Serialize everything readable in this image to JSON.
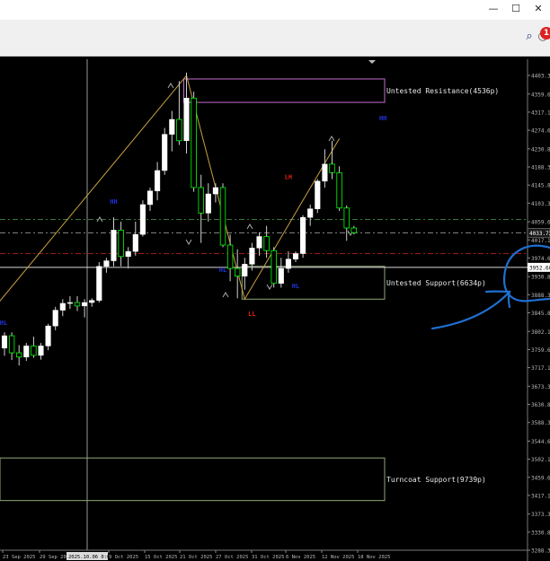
{
  "window": {
    "minimize_glyph": "—",
    "maximize_glyph": "☐",
    "close_glyph": "✕"
  },
  "toolbar": {
    "icons": [
      "search-icon",
      "notification-icon"
    ],
    "notification_badge": "1"
  },
  "colors": {
    "background": "#000000",
    "bull_candle": "#ffffff",
    "bear_candle": "#000000",
    "wick": "#ffffff",
    "zigzag": "#c8a040",
    "resistance_zone": "#c46fd0",
    "support_zone": "#8fa97a",
    "turncoat_zone": "#8fa97a",
    "swing_high_label": "#2233dd",
    "swing_low_label": "#dd2211",
    "annotation_pen": "#1f6fd0",
    "axis_text": "#b8b8b8"
  },
  "chart_data": {
    "type": "candlestick",
    "instrument_price_axis": {
      "ticks": [
        "4403.35",
        "4359.60",
        "4317.10",
        "4274.60",
        "4230.85",
        "4188.35",
        "4145.85",
        "4103.35",
        "4059.60",
        "4017.10",
        "3974.60",
        "3930.85",
        "3888.35",
        "3845.85",
        "3802.10",
        "3759.60",
        "3717.10",
        "3673.35",
        "3630.85",
        "3588.35",
        "3544.60",
        "3502.10",
        "3459.60",
        "3417.10",
        "3373.35",
        "3330.85",
        "3288.35"
      ],
      "ylim": [
        3288.35,
        4403.35
      ],
      "current_price": "4033.73",
      "marked_price": "3952.60"
    },
    "time_axis": {
      "ticks": [
        "23 Sep 2025",
        "29 Sep 2025",
        "2025.10.06 0:00",
        "9 Oct 2025",
        "15 Oct 2025",
        "21 Oct 2025",
        "27 Oct 2025",
        "31 Oct 2025",
        "6 Nov 2025",
        "12 Nov 2025",
        "18 Nov 2025"
      ],
      "crosshair_label": "2025.10.06 0:00"
    },
    "candles": [
      {
        "o": 3763,
        "h": 3800,
        "l": 3745,
        "c": 3792
      },
      {
        "o": 3792,
        "h": 3800,
        "l": 3735,
        "c": 3752
      },
      {
        "o": 3752,
        "h": 3770,
        "l": 3722,
        "c": 3742
      },
      {
        "o": 3742,
        "h": 3775,
        "l": 3733,
        "c": 3768
      },
      {
        "o": 3768,
        "h": 3790,
        "l": 3740,
        "c": 3746
      },
      {
        "o": 3746,
        "h": 3775,
        "l": 3736,
        "c": 3768
      },
      {
        "o": 3768,
        "h": 3820,
        "l": 3758,
        "c": 3815
      },
      {
        "o": 3815,
        "h": 3860,
        "l": 3805,
        "c": 3852
      },
      {
        "o": 3852,
        "h": 3878,
        "l": 3838,
        "c": 3868
      },
      {
        "o": 3868,
        "h": 3885,
        "l": 3855,
        "c": 3870
      },
      {
        "o": 3870,
        "h": 3885,
        "l": 3850,
        "c": 3862
      },
      {
        "o": 3862,
        "h": 3878,
        "l": 3835,
        "c": 3870
      },
      {
        "o": 3870,
        "h": 3880,
        "l": 3860,
        "c": 3875
      },
      {
        "o": 3875,
        "h": 3965,
        "l": 3870,
        "c": 3955
      },
      {
        "o": 3955,
        "h": 3975,
        "l": 3940,
        "c": 3968
      },
      {
        "o": 3968,
        "h": 4070,
        "l": 3955,
        "c": 4040
      },
      {
        "o": 4040,
        "h": 4060,
        "l": 3955,
        "c": 3978
      },
      {
        "o": 3978,
        "h": 4000,
        "l": 3950,
        "c": 3990
      },
      {
        "o": 3990,
        "h": 4060,
        "l": 3980,
        "c": 4030
      },
      {
        "o": 4030,
        "h": 4110,
        "l": 4025,
        "c": 4100
      },
      {
        "o": 4100,
        "h": 4140,
        "l": 4085,
        "c": 4132
      },
      {
        "o": 4132,
        "h": 4200,
        "l": 4110,
        "c": 4180
      },
      {
        "o": 4180,
        "h": 4280,
        "l": 4170,
        "c": 4265
      },
      {
        "o": 4265,
        "h": 4320,
        "l": 4225,
        "c": 4300
      },
      {
        "o": 4300,
        "h": 4390,
        "l": 4240,
        "c": 4250
      },
      {
        "o": 4250,
        "h": 4410,
        "l": 4220,
        "c": 4350
      },
      {
        "o": 4350,
        "h": 4365,
        "l": 4130,
        "c": 4140
      },
      {
        "o": 4140,
        "h": 4170,
        "l": 4010,
        "c": 4080
      },
      {
        "o": 4080,
        "h": 4150,
        "l": 4060,
        "c": 4125
      },
      {
        "o": 4125,
        "h": 4150,
        "l": 4105,
        "c": 4140
      },
      {
        "o": 4140,
        "h": 4150,
        "l": 4000,
        "c": 4005
      },
      {
        "o": 4005,
        "h": 4030,
        "l": 3920,
        "c": 3950
      },
      {
        "o": 3950,
        "h": 3995,
        "l": 3880,
        "c": 3932
      },
      {
        "o": 3932,
        "h": 3975,
        "l": 3900,
        "c": 3960
      },
      {
        "o": 3960,
        "h": 4010,
        "l": 3945,
        "c": 3998
      },
      {
        "o": 3998,
        "h": 4035,
        "l": 3980,
        "c": 4025
      },
      {
        "o": 4025,
        "h": 4050,
        "l": 3975,
        "c": 3992
      },
      {
        "o": 3992,
        "h": 4000,
        "l": 3905,
        "c": 3915
      },
      {
        "o": 3915,
        "h": 3975,
        "l": 3905,
        "c": 3950
      },
      {
        "o": 3950,
        "h": 3990,
        "l": 3940,
        "c": 3972
      },
      {
        "o": 3972,
        "h": 3990,
        "l": 3965,
        "c": 3985
      },
      {
        "o": 3985,
        "h": 4075,
        "l": 3975,
        "c": 4070
      },
      {
        "o": 4070,
        "h": 4100,
        "l": 4050,
        "c": 4090
      },
      {
        "o": 4090,
        "h": 4160,
        "l": 4080,
        "c": 4155
      },
      {
        "o": 4155,
        "h": 4230,
        "l": 4140,
        "c": 4195
      },
      {
        "o": 4195,
        "h": 4250,
        "l": 4160,
        "c": 4175
      },
      {
        "o": 4175,
        "h": 4190,
        "l": 4085,
        "c": 4092
      },
      {
        "o": 4092,
        "h": 4098,
        "l": 4015,
        "c": 4045
      },
      {
        "o": 4045,
        "h": 4050,
        "l": 4030,
        "c": 4034
      }
    ],
    "zigzag_points": [
      {
        "bar": -1,
        "price": 3866
      },
      {
        "bar": 25,
        "price": 4403
      },
      {
        "bar": 33,
        "price": 3878
      },
      {
        "bar": 46,
        "price": 4255
      }
    ],
    "zones": [
      {
        "label": "Untested Resistance(4536p)",
        "top": 4395,
        "bottom": 4340,
        "from_bar": 25
      },
      {
        "label": "Untested Support(6634p)",
        "top": 3955,
        "bottom": 3878,
        "from_bar": 33
      },
      {
        "label": "Turncoat Support(9739p)",
        "top": 3505,
        "bottom": 3405,
        "from_bar": -5
      }
    ],
    "swing_labels": [
      {
        "text": "HH",
        "bar": 15,
        "price": 4102,
        "color": "blue"
      },
      {
        "text": "HL",
        "bar": 30,
        "price": 3942,
        "color": "blue"
      },
      {
        "text": "LH",
        "bar": 39,
        "price": 4160,
        "color": "red"
      },
      {
        "text": "LL",
        "bar": 34,
        "price": 3838,
        "color": "red"
      },
      {
        "text": "HL",
        "bar": 40,
        "price": 3904,
        "color": "blue"
      },
      {
        "text": "HH",
        "bar": 52,
        "price": 4298,
        "color": "blue"
      },
      {
        "text": "HL",
        "bar": -1,
        "price": 3817,
        "color": "blue"
      }
    ],
    "dashed_lines": [
      {
        "price": 4065,
        "color": "#3b7a3b"
      },
      {
        "price": 4033.73,
        "color": "#888888"
      },
      {
        "price": 3985,
        "color": "#a01a1a"
      }
    ]
  }
}
